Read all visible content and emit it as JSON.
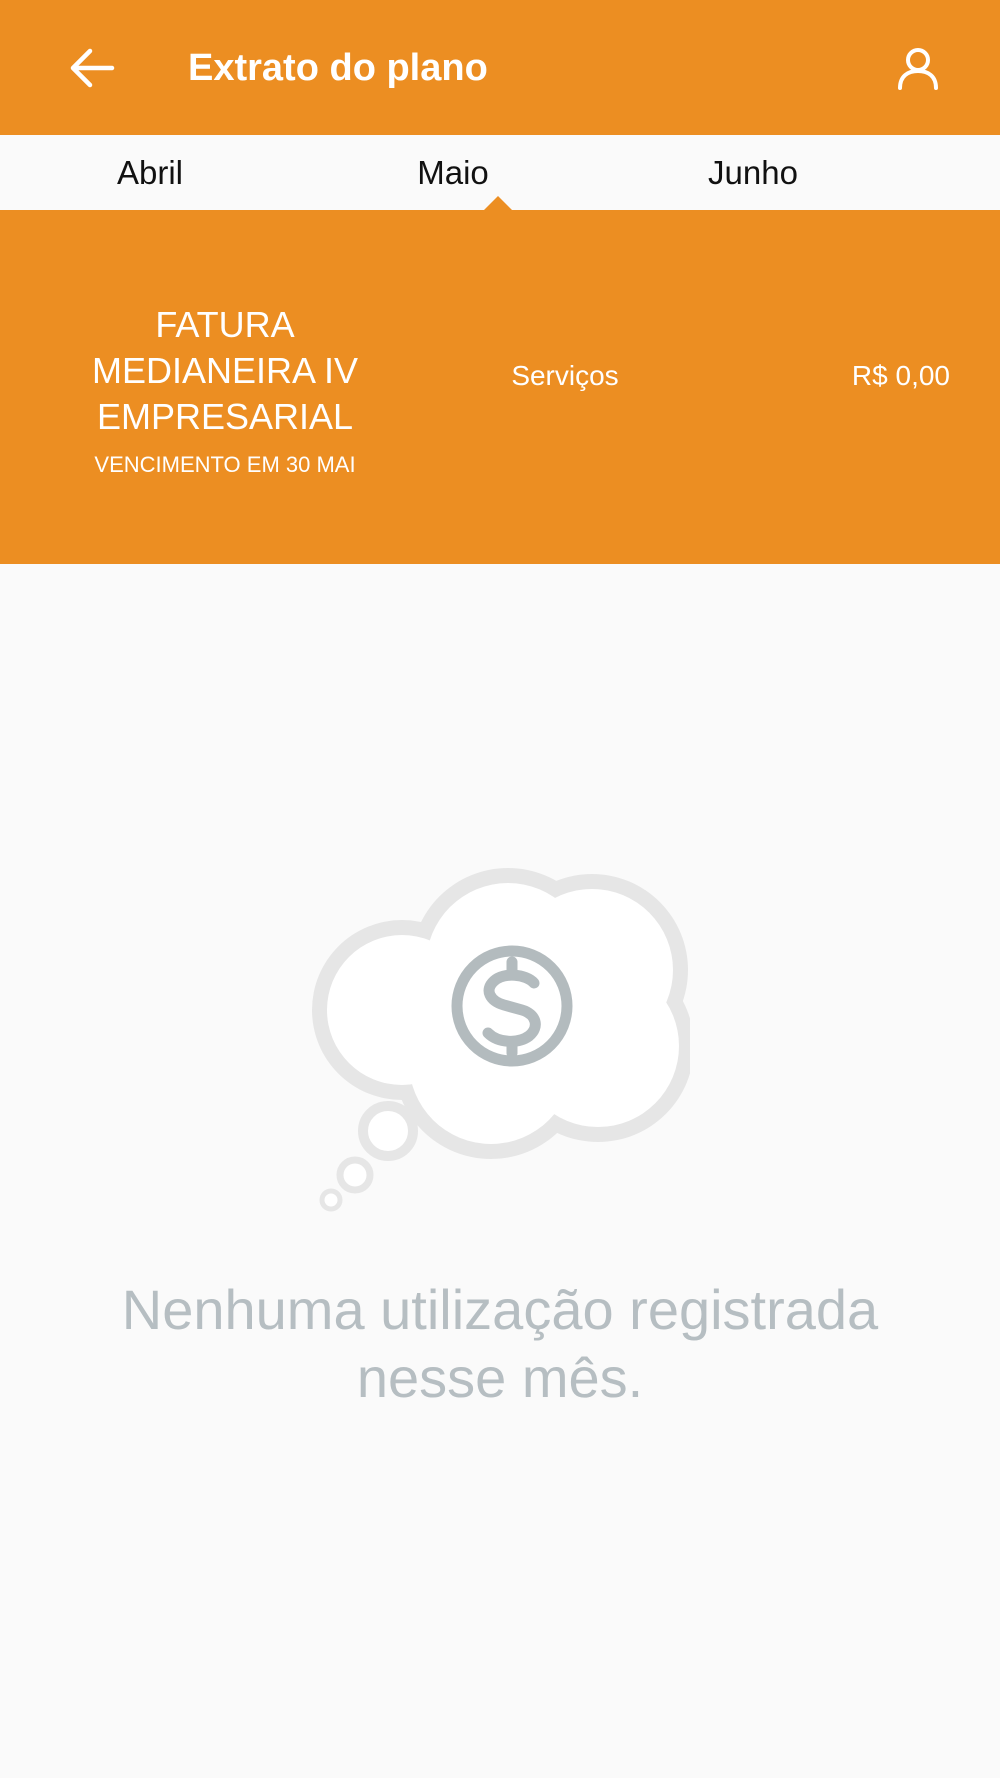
{
  "header": {
    "title": "Extrato do plano",
    "back_icon": "arrow-left-icon",
    "profile_icon": "user-icon"
  },
  "tabs": [
    {
      "label": "Abril",
      "selected": false
    },
    {
      "label": "Maio",
      "selected": true
    },
    {
      "label": "Junho",
      "selected": false
    }
  ],
  "invoice": {
    "name": "FATURA MEDIANEIRA IV EMPRESARIAL",
    "due": "VENCIMENTO EM 30 MAI",
    "services_label": "Serviços",
    "amount": "R$ 0,00"
  },
  "empty_state": {
    "icon": "dollar-thought-cloud-icon",
    "message": "Nenhuma utilização registrada nesse mês."
  },
  "colors": {
    "brand": "#ec8e22",
    "background": "#fafafa",
    "muted_text": "#b6bec2"
  }
}
